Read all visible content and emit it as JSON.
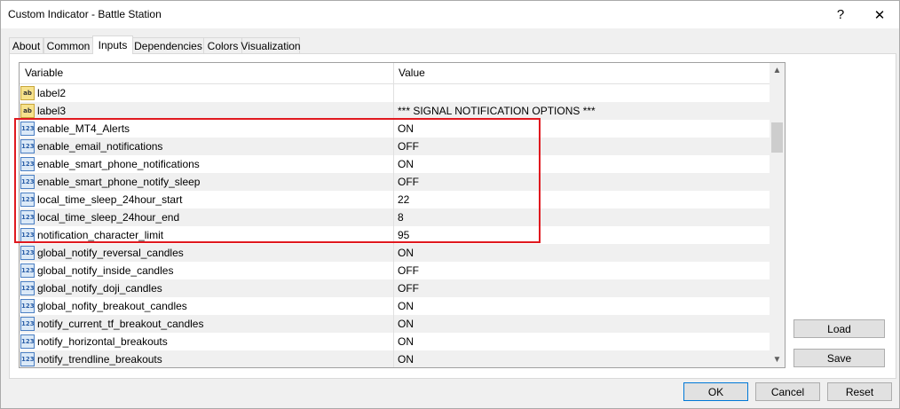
{
  "window": {
    "title": "Custom Indicator - Battle Station",
    "help_glyph": "?",
    "close_glyph": "✕"
  },
  "tabs": [
    {
      "label": "About"
    },
    {
      "label": "Common"
    },
    {
      "label": "Inputs"
    },
    {
      "label": "Dependencies"
    },
    {
      "label": "Colors"
    },
    {
      "label": "Visualization"
    }
  ],
  "active_tab": "Inputs",
  "grid": {
    "headers": {
      "variable": "Variable",
      "value": "Value"
    },
    "rows": [
      {
        "icon": "ab",
        "icon_text": "ab",
        "name": "label2",
        "value": ""
      },
      {
        "icon": "ab",
        "icon_text": "ab",
        "name": "label3",
        "value": "*** SIGNAL NOTIFICATION OPTIONS ***"
      },
      {
        "icon": "123",
        "icon_text": "123",
        "name": "enable_MT4_Alerts",
        "value": "ON"
      },
      {
        "icon": "123",
        "icon_text": "123",
        "name": "enable_email_notifications",
        "value": "OFF"
      },
      {
        "icon": "123",
        "icon_text": "123",
        "name": "enable_smart_phone_notifications",
        "value": "ON"
      },
      {
        "icon": "123",
        "icon_text": "123",
        "name": "enable_smart_phone_notify_sleep",
        "value": "OFF"
      },
      {
        "icon": "123",
        "icon_text": "123",
        "name": "local_time_sleep_24hour_start",
        "value": "22"
      },
      {
        "icon": "123",
        "icon_text": "123",
        "name": "local_time_sleep_24hour_end",
        "value": "8"
      },
      {
        "icon": "123",
        "icon_text": "123",
        "name": "notification_character_limit",
        "value": "95"
      },
      {
        "icon": "123",
        "icon_text": "123",
        "name": "global_notify_reversal_candles",
        "value": "ON"
      },
      {
        "icon": "123",
        "icon_text": "123",
        "name": "global_notify_inside_candles",
        "value": "OFF"
      },
      {
        "icon": "123",
        "icon_text": "123",
        "name": "global_notify_doji_candles",
        "value": "OFF"
      },
      {
        "icon": "123",
        "icon_text": "123",
        "name": "global_nofity_breakout_candles",
        "value": "ON"
      },
      {
        "icon": "123",
        "icon_text": "123",
        "name": "notify_current_tf_breakout_candles",
        "value": "ON"
      },
      {
        "icon": "123",
        "icon_text": "123",
        "name": "notify_horizontal_breakouts",
        "value": "ON"
      },
      {
        "icon": "123",
        "icon_text": "123",
        "name": "notify_trendline_breakouts",
        "value": "ON"
      }
    ]
  },
  "side_buttons": {
    "load": "Load",
    "save": "Save"
  },
  "footer_buttons": {
    "ok": "OK",
    "cancel": "Cancel",
    "reset": "Reset"
  },
  "colors": {
    "highlight_border": "#e0191f",
    "default_button_border": "#0078d7"
  }
}
